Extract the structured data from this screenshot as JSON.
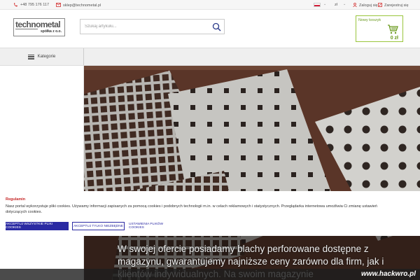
{
  "topbar": {
    "phone": "+48 795 176 117",
    "email": "sklep@technometal.pl",
    "currency": "zł",
    "login": "Zaloguj się",
    "register": "Zarejestruj się",
    "icons": [
      "phone-icon",
      "mail-icon",
      "poland-flag-icon",
      "user-icon",
      "edit-icon"
    ]
  },
  "logo": {
    "brand": "technometal",
    "sub": "spółka z o.o."
  },
  "search": {
    "placeholder": "Szukaj artykułu..."
  },
  "cart": {
    "title": "Nowy koszyk",
    "amount": "0 zł"
  },
  "nav": {
    "categories": "Kategorie"
  },
  "hero": {
    "text": "W swojej ofercie posiadamy blachy perforowane dostępne z magazynu, gwarantujemy najniższe ceny zarówno dla firm, jak i klientów indywidualnych. Na swoim magazynie"
  },
  "cookie": {
    "title": "Regulamin",
    "text": "Nasz portal wykorzystuje pliki cookies. Używamy informacji zapisanych za pomocą cookies i podobnych technologii m.in. w celach reklamowych i statystycznych. Przeglądarka internetowa umożliwia Ci zmianę ustawień dotyczących cookies.",
    "accept_all": "AKCEPTUJ WSZYSTKIE PLIKI COOKIES",
    "accept_necessary": "AKCEPTUJ TYLKO NIEZBĘDNE",
    "settings": "USTAWIENIA PLIKÓW COOKIES"
  },
  "watermark": "www.hackwro.pl",
  "colors": {
    "accent_red": "#d32f2f",
    "cart_green": "#9ac53c",
    "button_blue": "#2b2aa3"
  }
}
